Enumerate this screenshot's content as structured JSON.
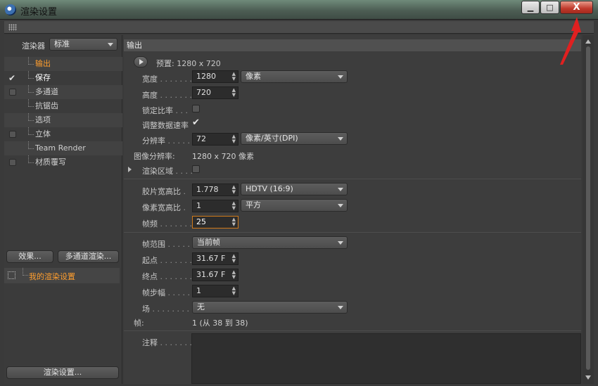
{
  "window": {
    "title": "渲染设置",
    "min_glyph": "▁",
    "max_glyph": "□",
    "close_glyph": "X"
  },
  "left": {
    "renderer_label": "渲染器",
    "renderer_value": "标准",
    "tree": [
      {
        "label": "输出",
        "state": "active",
        "check": "none"
      },
      {
        "label": "保存",
        "state": "bright",
        "check": "tick"
      },
      {
        "label": "多通道",
        "state": "normal",
        "check": "box"
      },
      {
        "label": "抗锯齿",
        "state": "normal",
        "check": "none"
      },
      {
        "label": "选项",
        "state": "normal",
        "check": "none"
      },
      {
        "label": "立体",
        "state": "normal",
        "check": "box"
      },
      {
        "label": "Team Render",
        "state": "normal",
        "check": "none"
      },
      {
        "label": "材质覆写",
        "state": "normal",
        "check": "box"
      }
    ],
    "effects_button": "效果...",
    "multipass_button": "多通道渲染...",
    "my_settings": "我的渲染设置",
    "render_settings_button": "渲染设置..."
  },
  "right": {
    "section_title": "输出",
    "preset": "预置: 1280 x 720",
    "width_label": "宽度",
    "width_value": "1280",
    "width_unit": "像素",
    "height_label": "高度",
    "height_value": "720",
    "lock_ratio_label": "锁定比率",
    "adjust_rate_label": "调整数据速率",
    "resolution_label": "分辨率",
    "resolution_value": "72",
    "resolution_unit": "像素/英寸(DPI)",
    "image_res_label": "图像分辨率:",
    "image_res_value": "1280 x 720 像素",
    "render_region_label": "渲染区域",
    "film_aspect_label": "胶片宽高比",
    "film_aspect_value": "1.778",
    "film_aspect_preset": "HDTV (16:9)",
    "pixel_aspect_label": "像素宽高比",
    "pixel_aspect_value": "1",
    "pixel_aspect_preset": "平方",
    "fps_label": "帧频",
    "fps_value": "25",
    "frame_range_label": "帧范围",
    "frame_range_value": "当前帧",
    "start_label": "起点",
    "start_value": "31.67 F",
    "end_label": "终点",
    "end_value": "31.67 F",
    "frame_step_label": "帧步幅",
    "frame_step_value": "1",
    "field_label": "场",
    "field_value": "无",
    "frames_label": "帧:",
    "frames_value": "1 (从 38 到 38)",
    "notes_label": "注释"
  },
  "colors": {
    "accent": "#ff9e2e",
    "annotation_arrow": "#e02020"
  }
}
